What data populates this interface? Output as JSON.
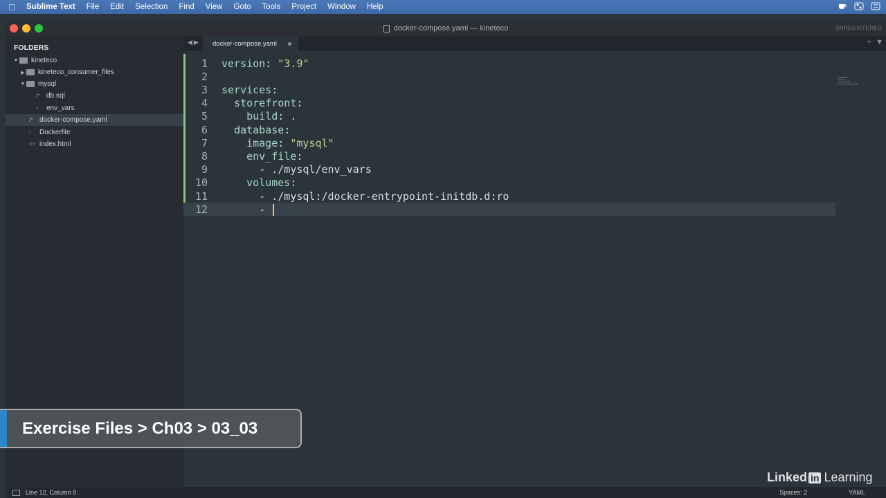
{
  "menubar": {
    "app": "Sublime Text",
    "items": [
      "File",
      "Edit",
      "Selection",
      "Find",
      "View",
      "Goto",
      "Tools",
      "Project",
      "Window",
      "Help"
    ],
    "tray_icons": [
      "cup-icon",
      "toggle-icon",
      "menu-icon"
    ]
  },
  "window": {
    "title": "docker-compose.yaml — kineteco",
    "unregistered": "UNREGISTERED"
  },
  "sidebar": {
    "header": "FOLDERS",
    "tree": [
      {
        "label": "kineteco",
        "kind": "folder",
        "expanded": true
      },
      {
        "label": "kineteco_consumer_files",
        "kind": "folder",
        "expanded": false
      },
      {
        "label": "mysql",
        "kind": "folder",
        "expanded": true
      },
      {
        "label": "db.sql",
        "kind": "file",
        "icon": "/*"
      },
      {
        "label": "env_vars",
        "kind": "file",
        "icon": ""
      },
      {
        "label": "docker-compose.yaml",
        "kind": "file",
        "icon": "/*",
        "selected": true
      },
      {
        "label": "Dockerfile",
        "kind": "file",
        "icon": ""
      },
      {
        "label": "index.html",
        "kind": "file",
        "icon": "<>"
      }
    ]
  },
  "tabs": [
    {
      "label": "docker-compose.yaml",
      "active": true
    }
  ],
  "editor": {
    "lines": [
      {
        "num": "1",
        "indent": "",
        "key": "version",
        "sep": ": ",
        "value": "\"3.9\""
      },
      {
        "num": "2",
        "indent": "",
        "key": "",
        "sep": "",
        "value": ""
      },
      {
        "num": "3",
        "indent": "",
        "key": "services",
        "sep": ":",
        "value": ""
      },
      {
        "num": "4",
        "indent": "  ",
        "key": "storefront",
        "sep": ":",
        "value": ""
      },
      {
        "num": "5",
        "indent": "    ",
        "key": "build",
        "sep": ": ",
        "value": "."
      },
      {
        "num": "6",
        "indent": "  ",
        "key": "database",
        "sep": ":",
        "value": ""
      },
      {
        "num": "7",
        "indent": "    ",
        "key": "image",
        "sep": ": ",
        "value": "\"mysql\""
      },
      {
        "num": "8",
        "indent": "    ",
        "key": "env_file",
        "sep": ":",
        "value": ""
      },
      {
        "num": "9",
        "indent": "      ",
        "key": "",
        "sep": "- ",
        "value": "./mysql/env_vars"
      },
      {
        "num": "10",
        "indent": "    ",
        "key": "volumes",
        "sep": ":",
        "value": ""
      },
      {
        "num": "11",
        "indent": "      ",
        "key": "",
        "sep": "- ",
        "value": "./mysql:/docker-entrypoint-initdb.d:ro"
      },
      {
        "num": "12",
        "indent": "      ",
        "key": "",
        "sep": "- ",
        "value": "",
        "current": true
      }
    ]
  },
  "statusbar": {
    "position": "Line 12, Column 9",
    "spaces": "Spaces: 2",
    "syntax": "YAML"
  },
  "overlay": {
    "exercise_path": "Exercise Files > Ch03 > 03_03",
    "watermark_a": "Linked",
    "watermark_in": "in",
    "watermark_b": "Learning"
  }
}
